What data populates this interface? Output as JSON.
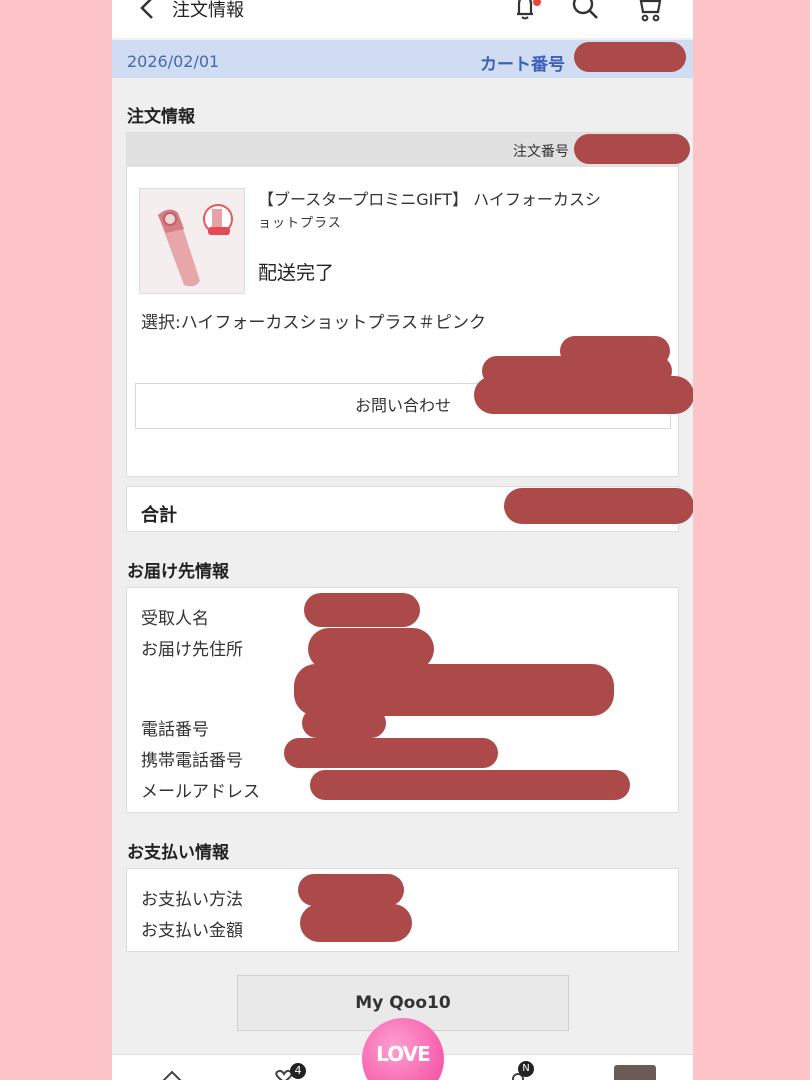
{
  "header": {
    "title": "注文情報",
    "back_icon": "chevron-left-icon",
    "bell_icon": "bell-icon",
    "search_icon": "search-icon",
    "cart_icon": "cart-icon"
  },
  "datebar": {
    "date": "2026/02/01",
    "cart_number_label": "カート番号"
  },
  "order_section": {
    "title": "注文情報",
    "order_number_label": "注文番号",
    "product_name_line1": "【ブースタープロミニGIFT】 ハイフォーカスシ",
    "product_name_line2": "ョットプラス",
    "status": "配送完了",
    "option": "選択:ハイフォーカスショットプラス＃ピンク",
    "inquiry_button": "お問い合わせ",
    "total_label": "合計"
  },
  "delivery_section": {
    "title": "お届け先情報",
    "labels": [
      "受取人名",
      "お届け先住所",
      "電話番号",
      "携帯電話番号",
      "メールアドレス"
    ]
  },
  "payment_section": {
    "title": "お支払い情報",
    "labels": [
      "お支払い方法",
      "お支払い金額"
    ]
  },
  "myqoo10_button": "My Qoo10",
  "bottom_nav": {
    "love_label": "LOVE",
    "wishlist_badge": "4",
    "notice_badge": "N"
  },
  "colors": {
    "background": "#fcc4c6",
    "date_bar": "#cfdcf1",
    "link_blue": "#3d62b8",
    "redaction": "#ab4a48"
  }
}
